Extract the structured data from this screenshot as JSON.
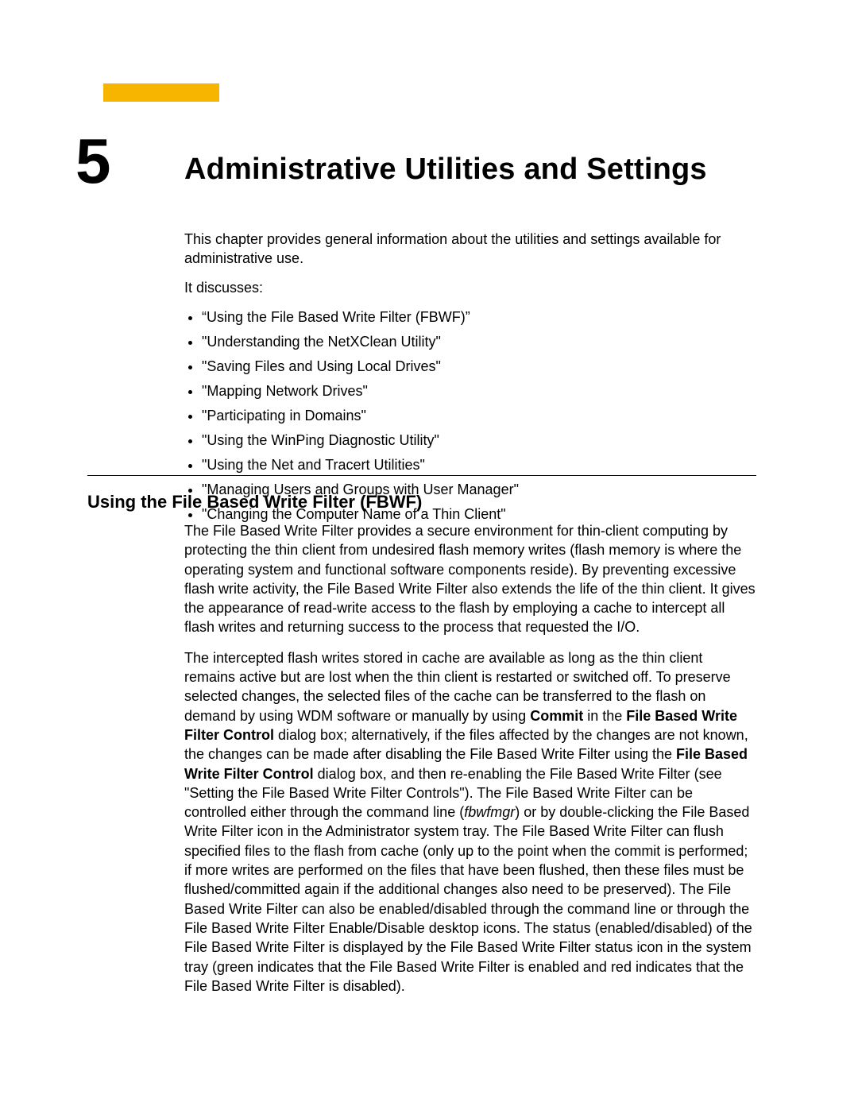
{
  "chapter": {
    "number": "5",
    "title": "Administrative Utilities and Settings"
  },
  "intro": {
    "p1": "This chapter provides general information about the utilities and settings available for administrative use.",
    "p2": "It discusses:",
    "bullets": [
      "“Using the File Based Write Filter (FBWF)”",
      "\"Understanding the NetXClean Utility\"",
      "\"Saving Files and Using Local Drives\"",
      "\"Mapping Network Drives\"",
      "\"Participating in Domains\"",
      "\"Using the WinPing Diagnostic Utility\"",
      "\"Using the Net and Tracert Utilities\"",
      "\"Managing Users and Groups with User Manager\"",
      "\"Changing the Computer Name of a Thin Client\""
    ]
  },
  "section": {
    "heading": "Using the File Based Write Filter (FBWF)",
    "p1": "The File Based Write Filter provides a secure environment for thin-client computing by protecting the thin client from undesired flash memory writes (flash memory is where the operating system and functional software components reside). By preventing excessive flash write activity, the File Based Write Filter also extends the life of the thin client. It gives the appearance of read-write access to the flash by employing a cache to intercept all flash writes and returning success to the process that requested the I/O.",
    "p2": {
      "t1": "The intercepted flash writes stored in cache are available as long as the thin client remains active but are lost when the thin client is restarted or switched off. To preserve selected changes, the selected files of the cache can be transferred to the flash on demand by using WDM software or manually by using ",
      "b1": "Commit",
      "t2": " in the ",
      "b2": "File Based Write Filter Control",
      "t3": " dialog box; alternatively, if the files affected by the changes are not known, the changes can be made after disabling the File Based Write Filter using the ",
      "b3": "File Based Write Filter Control",
      "t4": " dialog box, and then re-enabling the File Based Write Filter (see \"Setting the File Based Write Filter Controls\"). The File Based Write Filter can be controlled either through the command line (",
      "i1": "fbwfmgr",
      "t5": ") or by double-clicking the File Based Write Filter icon in the Administrator system tray. The File Based Write Filter can flush specified files to the flash from cache (only up to the point when the commit is performed; if more writes are performed on the files that have been flushed, then these files must be flushed/committed again if the additional changes also need to be preserved). The File Based Write Filter can also be enabled/disabled through the command line or through the File Based Write Filter Enable/Disable desktop icons. The status (enabled/disabled) of the File Based Write Filter is displayed by the File Based Write Filter status icon in the system tray (green indicates that the File Based Write Filter is enabled and red indicates that the File Based Write Filter is disabled)."
    }
  }
}
